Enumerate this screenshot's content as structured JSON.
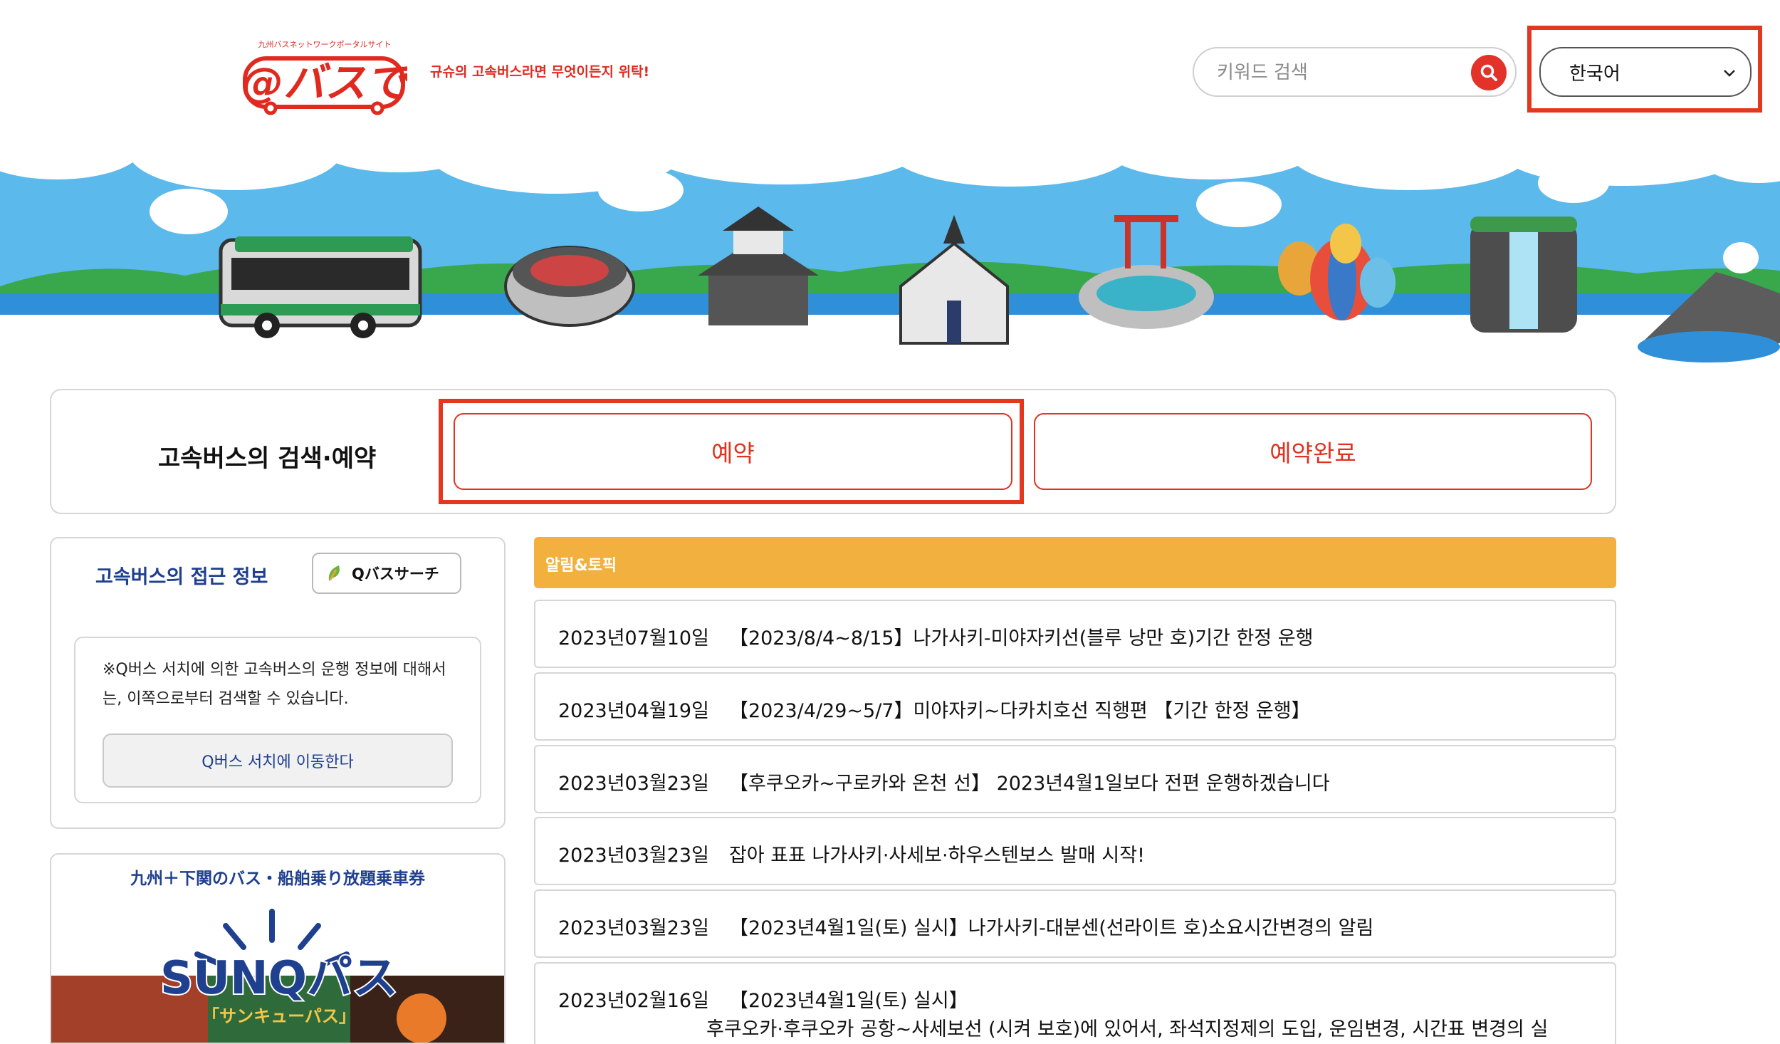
{
  "header": {
    "logo_text": "@バスで",
    "logo_subtitle": "九州バスネットワークポータルサイト",
    "tagline": "규슈의 고속버스라면 무엇이든지 위탁!",
    "search_placeholder": "키워드 검색",
    "language": "한국어"
  },
  "panel": {
    "title": "고속버스의 검색·예약",
    "reserve_label": "예약",
    "done_label": "예약완료"
  },
  "access": {
    "title": "고속버스의 접근 정보",
    "badge_label": "Qバスサーチ",
    "description": "※Q버스 서치에 의한 고속버스의 운행 정보에 대해서는, 이쪽으로부터 검색할 수 있습니다.",
    "button_label": "Q버스 서치에 이동한다"
  },
  "sunq": {
    "title": "九州＋下関のバス・船舶乗り放題乗車券",
    "logo_text": "SUNQパス",
    "logo_sub": "「サンキューパス」"
  },
  "news": {
    "header": "알림&토픽",
    "items": [
      {
        "date": "2023년07월10일",
        "text": "【2023/8/4~8/15】나가사키-미야자키선(블루 낭만 호)기간 한정 운행"
      },
      {
        "date": "2023년04월19일",
        "text": "【2023/4/29~5/7】미야자키~다카치호선 직행편 【기간 한정 운행】"
      },
      {
        "date": "2023년03월23일",
        "text": "【후쿠오카~구로카와 온천 선】 2023년4월1일보다 전편 운행하겠습니다"
      },
      {
        "date": "2023년03월23일",
        "text": "잡아 표표 나가사키·사세보·하우스텐보스 발매 시작!"
      },
      {
        "date": "2023년03월23일",
        "text": "【2023년4월1일(토) 실시】나가사키-대분센(선라이트 호)소요시간변경의 알림"
      },
      {
        "date": "2023년02월16일",
        "text": "【2023년4월1일(토) 실시】",
        "text2": "후쿠오카·후쿠오카 공항~사세보선 (시켜 보호)에 있어서, 좌석지정제의 도입, 운임변경, 시간표 변경의 실"
      }
    ]
  },
  "colors": {
    "accent_red": "#e2322a",
    "highlight_red": "#e2381f",
    "news_header": "#f2b13f",
    "navy": "#1f3f8f",
    "sky": "#5cb9ec"
  }
}
